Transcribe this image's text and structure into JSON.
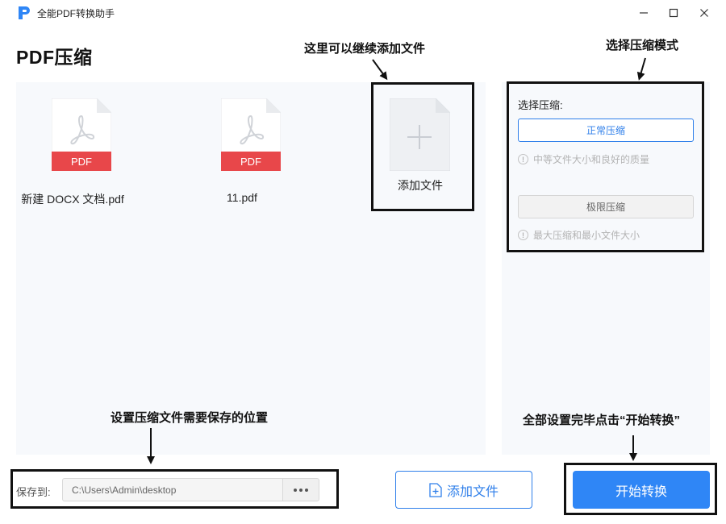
{
  "window": {
    "title": "全能PDF转换助手",
    "controls": [
      "minimize-icon",
      "maximize-icon",
      "close-icon"
    ]
  },
  "page": {
    "title": "PDF压缩"
  },
  "files": [
    {
      "name": "新建 DOCX 文档.pdf",
      "badge": "PDF",
      "icon": "pdf-file-icon"
    },
    {
      "name": "11.pdf",
      "badge": "PDF",
      "icon": "pdf-file-icon"
    }
  ],
  "add_tile": {
    "label": "添加文件",
    "icon": "plus-icon"
  },
  "compression": {
    "title": "选择压缩:",
    "options": [
      {
        "label": "正常压缩",
        "hint": "中等文件大小和良好的质量",
        "selected": true
      },
      {
        "label": "极限压缩",
        "hint": "最大压缩和最小文件大小",
        "selected": false
      }
    ]
  },
  "save": {
    "label": "保存到:",
    "path": "C:\\Users\\Admin\\desktop",
    "browse_icon": "ellipsis-icon"
  },
  "buttons": {
    "add_file": "添加文件",
    "start": "开始转换"
  },
  "annotations": {
    "add_more": "这里可以继续添加文件",
    "select_mode": "选择压缩模式",
    "save_location": "设置压缩文件需要保存的位置",
    "start_hint": "全部设置完毕点击“开始转换”"
  },
  "colors": {
    "accent": "#2f86f6",
    "pdf_red": "#e8474a",
    "panel_bg": "#f7f9fc",
    "annotation": "#111111"
  }
}
